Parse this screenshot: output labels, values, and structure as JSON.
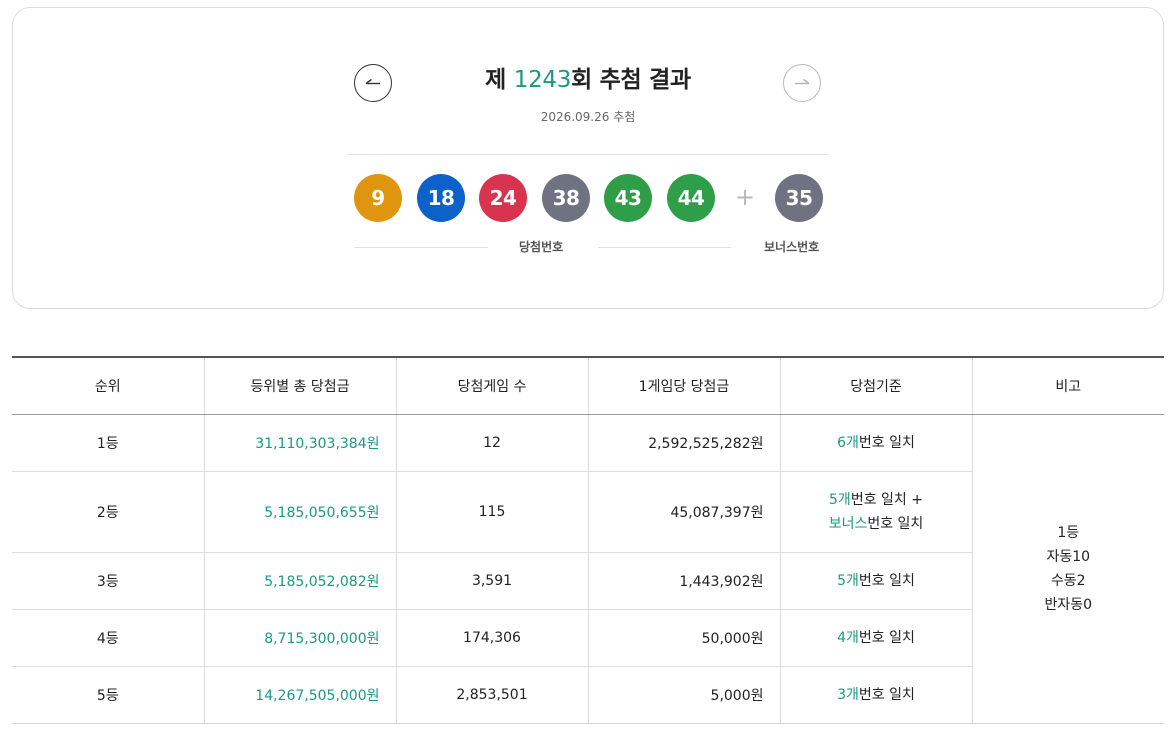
{
  "draw": {
    "title_prefix": "제 ",
    "round": "1243",
    "title_suffix": "회 추첨 결과",
    "date": "2026.09.26 추첨",
    "numbers": [
      "9",
      "18",
      "24",
      "38",
      "43",
      "44"
    ],
    "bonus": "35",
    "plus": "+",
    "winning_label": "당첨번호",
    "bonus_label": "보너스번호",
    "ball_colors": [
      "#e0950e",
      "#0d62c9",
      "#d9344f",
      "#6f7381",
      "#2e9e48",
      "#2e9e48"
    ],
    "bonus_color": "#6f7381",
    "accent_color": "#1a9a80"
  },
  "table": {
    "headers": [
      "순위",
      "등위별 총 당첨금",
      "당첨게임 수",
      "1게임당 당첨금",
      "당첨기준",
      "비고"
    ],
    "rows": [
      {
        "rank": "1등",
        "total": "31,110,303,384원",
        "count": "12",
        "per_game": "2,592,525,282원",
        "crit_1_hl": "6개",
        "crit_1_txt": "번호 일치",
        "crit_2_hl": "",
        "crit_2_txt": ""
      },
      {
        "rank": "2등",
        "total": "5,185,050,655원",
        "count": "115",
        "per_game": "45,087,397원",
        "crit_1_hl": "5개",
        "crit_1_txt": "번호 일치 +",
        "crit_2_hl": "보너스",
        "crit_2_txt": "번호 일치"
      },
      {
        "rank": "3등",
        "total": "5,185,052,082원",
        "count": "3,591",
        "per_game": "1,443,902원",
        "crit_1_hl": "5개",
        "crit_1_txt": "번호 일치",
        "crit_2_hl": "",
        "crit_2_txt": ""
      },
      {
        "rank": "4등",
        "total": "8,715,300,000원",
        "count": "174,306",
        "per_game": "50,000원",
        "crit_1_hl": "4개",
        "crit_1_txt": "번호 일치",
        "crit_2_hl": "",
        "crit_2_txt": ""
      },
      {
        "rank": "5등",
        "total": "14,267,505,000원",
        "count": "2,853,501",
        "per_game": "5,000원",
        "crit_1_hl": "3개",
        "crit_1_txt": "번호 일치",
        "crit_2_hl": "",
        "crit_2_txt": ""
      }
    ],
    "note": [
      "1등",
      "자동10",
      "수동2",
      "반자동0"
    ]
  }
}
